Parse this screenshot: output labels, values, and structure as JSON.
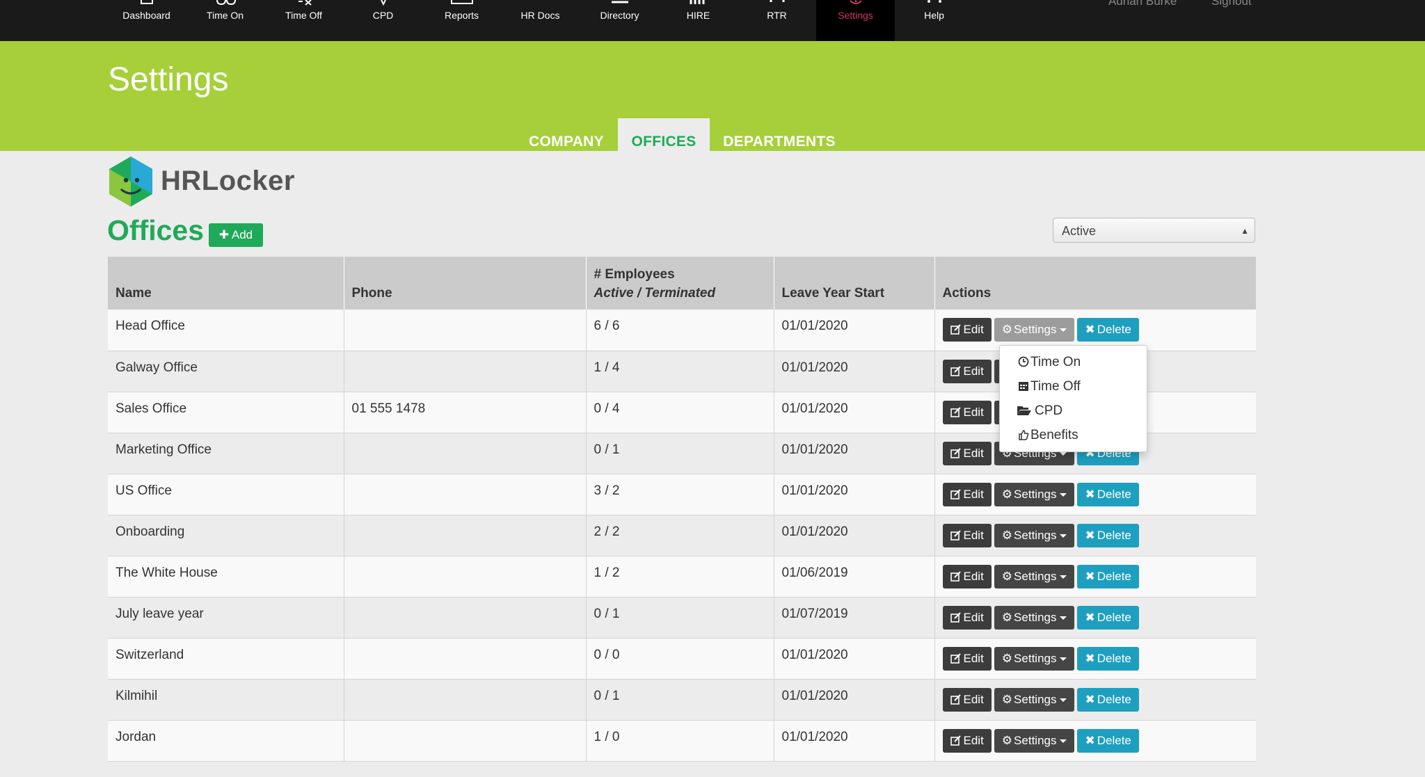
{
  "nav": {
    "items": [
      {
        "label": "Dashboard",
        "icon": "dashboard-icon"
      },
      {
        "label": "Time On",
        "icon": "clock-icon"
      },
      {
        "label": "Time Off",
        "icon": "plane-icon"
      },
      {
        "label": "CPD",
        "icon": "trophy-icon"
      },
      {
        "label": "Reports",
        "icon": "report-icon"
      },
      {
        "label": "HR Docs",
        "icon": "docs-icon"
      },
      {
        "label": "Directory",
        "icon": "directory-icon"
      },
      {
        "label": "HIRE",
        "icon": "hire-icon"
      },
      {
        "label": "RTR",
        "icon": "rtr-icon"
      },
      {
        "label": "Settings",
        "icon": "settings-icon",
        "active": true
      },
      {
        "label": "Help",
        "icon": "help-icon"
      }
    ],
    "user_name": "Adrian Burke",
    "signout": "Signout"
  },
  "header": {
    "title": "Settings",
    "tabs": [
      "COMPANY",
      "OFFICES",
      "DEPARTMENTS"
    ],
    "active_tab": "OFFICES"
  },
  "brand": {
    "name": "HRLocker"
  },
  "section": {
    "title": "Offices",
    "add_label": "Add"
  },
  "filter": {
    "selected": "Active"
  },
  "table": {
    "headers": {
      "name": "Name",
      "phone": "Phone",
      "employees": "# Employees",
      "employees_sub": "Active / Terminated",
      "leave_year": "Leave Year Start",
      "actions": "Actions"
    },
    "rows": [
      {
        "name": "Head Office",
        "phone": "",
        "employees": "6 / 6",
        "leave": "01/01/2020"
      },
      {
        "name": "Galway Office",
        "phone": "",
        "employees": "1 / 4",
        "leave": "01/01/2020"
      },
      {
        "name": "Sales Office",
        "phone": "01 555 1478",
        "employees": "0 / 4",
        "leave": "01/01/2020"
      },
      {
        "name": "Marketing Office",
        "phone": "",
        "employees": "0 / 1",
        "leave": "01/01/2020"
      },
      {
        "name": "US Office",
        "phone": "",
        "employees": "3 / 2",
        "leave": "01/01/2020"
      },
      {
        "name": "Onboarding",
        "phone": "",
        "employees": "2 / 2",
        "leave": "01/01/2020"
      },
      {
        "name": "The White House",
        "phone": "",
        "employees": "1 / 2",
        "leave": "01/06/2019"
      },
      {
        "name": "July leave year",
        "phone": "",
        "employees": "0 / 1",
        "leave": "01/07/2019"
      },
      {
        "name": "Switzerland",
        "phone": "",
        "employees": "0 / 0",
        "leave": "01/01/2020"
      },
      {
        "name": "Kilmihil",
        "phone": "",
        "employees": "0 / 1",
        "leave": "01/01/2020"
      },
      {
        "name": "Jordan",
        "phone": "",
        "employees": "1 / 0",
        "leave": "01/01/2020"
      }
    ],
    "actions": {
      "edit": "Edit",
      "settings": "Settings",
      "delete": "Delete"
    }
  },
  "settings_menu": {
    "items": [
      {
        "label": "Time On",
        "icon": "clock-icon"
      },
      {
        "label": "Time Off",
        "icon": "calendar-icon"
      },
      {
        "label": "CPD",
        "icon": "folder-open-icon"
      },
      {
        "label": "Benefits",
        "icon": "thumbs-up-icon"
      }
    ]
  },
  "colors": {
    "brand_green": "#a6cf39",
    "accent_green": "#1faa59",
    "delete_blue": "#1e9fbf",
    "nav_active": "#d6336c"
  }
}
